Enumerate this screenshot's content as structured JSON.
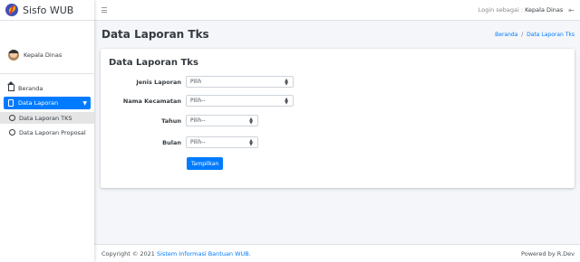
{
  "app": {
    "title": "Sisfo WUB"
  },
  "user": {
    "name": "Kepala Dinas"
  },
  "sidebar": {
    "items": [
      {
        "label": "Beranda",
        "icon": "home-icon"
      },
      {
        "label": "Data Laporan",
        "icon": "file-icon",
        "active": true
      },
      {
        "label": "Data Laporan TKS",
        "icon": "circle-icon",
        "active": true
      },
      {
        "label": "Data Laporan Proposal",
        "icon": "circle-icon"
      }
    ]
  },
  "topbar": {
    "login_prefix": "Login sebagai : ",
    "login_user": "Kepala Dinas",
    "logout_icon": "logout-icon"
  },
  "page": {
    "title": "Data Laporan Tks",
    "breadcrumb": {
      "home": "Beranda",
      "separator": "/",
      "current": "Data Laporan Tks"
    }
  },
  "card": {
    "title": "Data Laporan Tks",
    "fields": [
      {
        "label": "Jenis Laporan",
        "value": "Pilih"
      },
      {
        "label": "Nama Kecamatan",
        "value": "Pilih--"
      },
      {
        "label": "Tahun",
        "value": "Pilih--"
      },
      {
        "label": "Bulan",
        "value": "Pilih--"
      }
    ],
    "submit_label": "Tampilkan"
  },
  "footer": {
    "copyright": "Copyright © 2021 ",
    "link": "Sistem Informasi Bantuan WUB.",
    "powered_prefix": "Powered by ",
    "powered_by": "R.Dev"
  },
  "colors": {
    "accent": "#007bff",
    "background": "#f4f6f9"
  }
}
